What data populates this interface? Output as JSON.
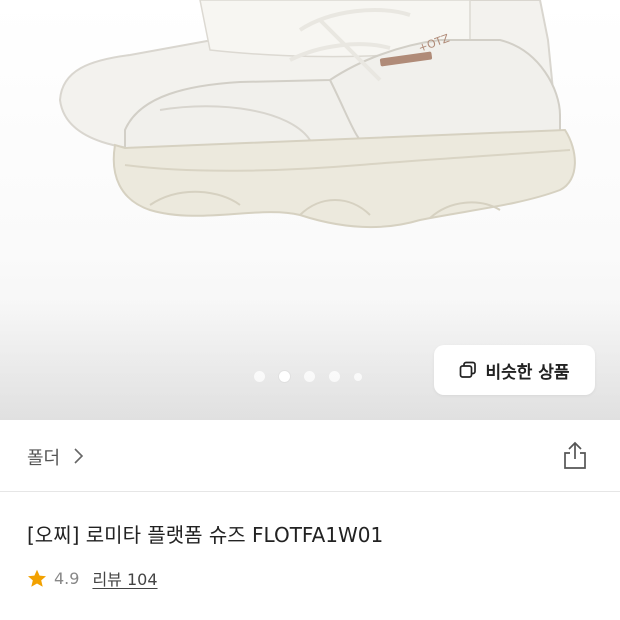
{
  "product_image": {
    "alt_icon": "white-platform-sneaker-image",
    "carousel": {
      "count": 5,
      "active_index": 1
    }
  },
  "similar_button": {
    "label": "비슷한 상품",
    "icon": "copy-squares-icon"
  },
  "folder": {
    "label": "폴더",
    "icon": "chevron-right-icon"
  },
  "share": {
    "icon": "share-icon"
  },
  "product": {
    "title": "[오찌] 로미타 플랫폼 슈즈 FLOTFA1W01",
    "rating": "4.9",
    "review_label": "리뷰 104"
  },
  "colors": {
    "star": "#f2a100",
    "text": "#222222",
    "muted": "#888888"
  }
}
